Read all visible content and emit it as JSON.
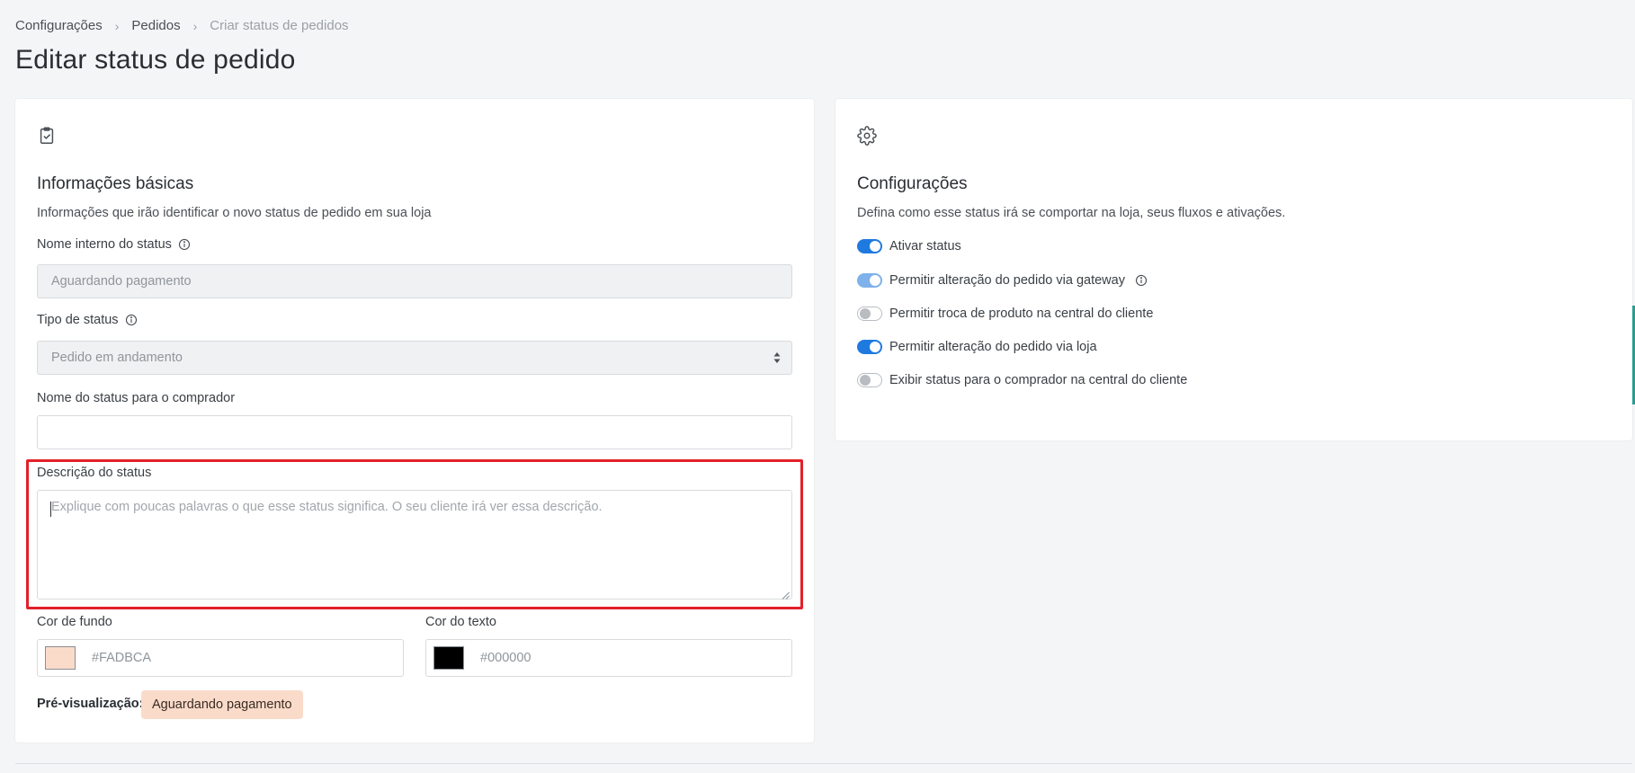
{
  "breadcrumb": {
    "items": [
      "Configurações",
      "Pedidos",
      "Criar status de pedidos"
    ],
    "separator": "›"
  },
  "page": {
    "title": "Editar status de pedido"
  },
  "basic_info": {
    "icon": "clipboard-check-icon",
    "title": "Informações básicas",
    "description": "Informações que irão identificar o novo status de pedido em sua loja",
    "internal_name": {
      "label": "Nome interno do status",
      "value": "Aguardando pagamento"
    },
    "status_type": {
      "label": "Tipo de status",
      "value": "Pedido em andamento"
    },
    "buyer_name": {
      "label": "Nome do status para o comprador",
      "value": ""
    },
    "description_field": {
      "label": "Descrição do status",
      "placeholder": "Explique com poucas palavras o que esse status significa. O seu cliente irá ver essa descrição."
    },
    "background_color": {
      "label": "Cor de fundo",
      "value": "#FADBCA"
    },
    "text_color": {
      "label": "Cor do texto",
      "value": "#000000"
    },
    "preview": {
      "label": "Pré-visualização:",
      "badge_text": "Aguardando pagamento"
    }
  },
  "settings": {
    "icon": "gear-icon",
    "title": "Configurações",
    "description": "Defina como esse status irá se comportar na loja, seus fluxos e ativações.",
    "toggles": [
      {
        "label": "Ativar status",
        "state": "on",
        "info": false
      },
      {
        "label": "Permitir alteração do pedido via gateway",
        "state": "on-disabled",
        "info": true
      },
      {
        "label": "Permitir troca de produto na central do cliente",
        "state": "off",
        "info": false
      },
      {
        "label": "Permitir alteração do pedido via loja",
        "state": "on",
        "info": false
      },
      {
        "label": "Exibir status para o comprador na central do cliente",
        "state": "off",
        "info": false
      }
    ]
  },
  "colors": {
    "accent": "#1f7ae0",
    "highlight": "#e3202a",
    "background_swatch": "#FADBCA",
    "text_swatch": "#000000"
  }
}
